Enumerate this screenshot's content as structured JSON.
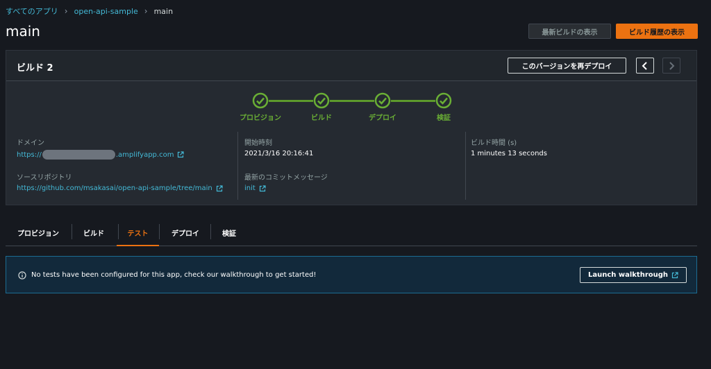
{
  "breadcrumb": {
    "items": [
      "すべてのアプリ",
      "open-api-sample",
      "main"
    ]
  },
  "page": {
    "title": "main",
    "buttons": {
      "latest_build": "最新ビルドの表示",
      "build_history": "ビルド履歴の表示"
    }
  },
  "build": {
    "title": "ビルド 2",
    "redeploy_label": "このバージョンを再デプロイ",
    "steps": [
      "プロビジョン",
      "ビルド",
      "デプロイ",
      "検証"
    ],
    "details": {
      "domain_label": "ドメイン",
      "domain_prefix": "https://",
      "domain_suffix": ".amplifyapp.com",
      "repo_label": "ソースリポジトリ",
      "repo_url": "https://github.com/msakasai/open-api-sample/tree/main",
      "start_label": "開始時刻",
      "start_value": "2021/3/16 20:16:41",
      "commit_label": "最新のコミットメッセージ",
      "commit_value": "init",
      "duration_label": "ビルド時間 (s)",
      "duration_value": "1 minutes 13 seconds"
    }
  },
  "tabs": {
    "items": [
      "プロビジョン",
      "ビルド",
      "テスト",
      "デプロイ",
      "検証"
    ],
    "active": "テスト"
  },
  "alert": {
    "message": "No tests have been configured for this app, check our walkthrough to get started!",
    "button": "Launch walkthrough"
  },
  "colors": {
    "background": "#16191f",
    "panel": "#252a31",
    "accent_orange": "#ec7211",
    "success_green": "#6aaf35",
    "link_blue": "#44b9d6",
    "info_bg": "#12293b"
  }
}
